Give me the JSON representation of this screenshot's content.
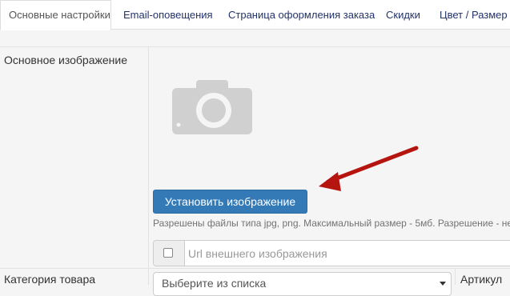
{
  "tabs": [
    {
      "label": "Основные настройки",
      "active": true
    },
    {
      "label": "Email-оповещения",
      "active": false
    },
    {
      "label": "Страница оформления заказа",
      "active": false
    },
    {
      "label": "Скидки",
      "active": false
    },
    {
      "label": "Цвет / Размер",
      "active": false
    }
  ],
  "main_image": {
    "label": "Основное изображение",
    "placeholder_icon": "camera-icon",
    "upload_button": "Установить изображение",
    "hint": "Разрешены файлы типа jpg, png. Максимальный размер - 5мб. Разрешение - не",
    "url_placeholder": "Url внешнего изображения"
  },
  "category": {
    "label": "Категория товара",
    "select_value": "Выберите из списка"
  },
  "article": {
    "label": "Артикул"
  },
  "colors": {
    "accent": "#337ab7",
    "arrow": "#b5140f",
    "tab_text": "#23336a"
  }
}
